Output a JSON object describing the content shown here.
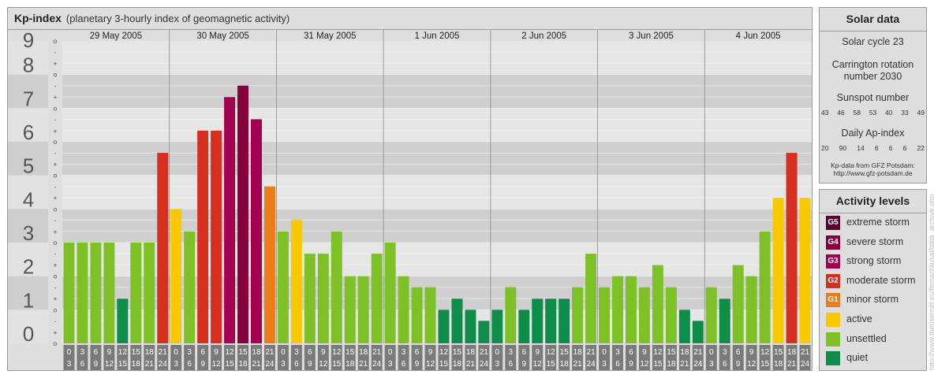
{
  "header": {
    "title": "Kp-index",
    "subtitle": "(planetary 3-hourly index of geomagnetic activity)"
  },
  "chart_data": {
    "type": "bar",
    "days": [
      "29 May 2005",
      "30 May 2005",
      "31 May 2005",
      "1 Jun 2005",
      "2 Jun 2005",
      "3 Jun 2005",
      "4 Jun 2005"
    ],
    "interval_labels": [
      [
        "0",
        "3"
      ],
      [
        "3",
        "6"
      ],
      [
        "6",
        "9"
      ],
      [
        "9",
        "12"
      ],
      [
        "12",
        "15"
      ],
      [
        "15",
        "18"
      ],
      [
        "18",
        "21"
      ],
      [
        "21",
        "24"
      ]
    ],
    "y_ticks": [
      "0",
      "1",
      "2",
      "3",
      "4",
      "5",
      "6",
      "7",
      "8",
      "9"
    ],
    "minor_ticks": [
      "o",
      "+",
      "-"
    ],
    "ylim": [
      0,
      9
    ],
    "values": [
      3.0,
      3.0,
      3.0,
      3.0,
      1.33,
      3.0,
      3.0,
      5.67,
      4.0,
      3.33,
      6.33,
      6.33,
      7.33,
      7.67,
      6.67,
      4.67,
      3.33,
      3.67,
      2.67,
      2.67,
      3.33,
      2.0,
      2.0,
      2.67,
      3.0,
      2.0,
      1.67,
      1.67,
      1.0,
      1.33,
      1.0,
      0.67,
      1.0,
      1.67,
      1.0,
      1.33,
      1.33,
      1.33,
      1.67,
      2.67,
      1.67,
      2.0,
      2.0,
      1.67,
      2.33,
      1.67,
      1.0,
      0.67,
      1.67,
      1.33,
      2.33,
      2.0,
      3.33,
      4.33,
      5.67,
      4.33
    ],
    "colors": {
      "quiet": "#0e8c4a",
      "unsettled": "#7dc126",
      "active": "#f9c800",
      "G1": "#ec7c1a",
      "G2": "#d42f1f",
      "G3": "#a5004f",
      "G4": "#86003e",
      "G5": "#5a0030"
    }
  },
  "solar": {
    "title": "Solar data",
    "cycle": "Solar cycle 23",
    "carrington_1": "Carrington rotation",
    "carrington_2": "number 2030",
    "sunspot_title": "Sunspot number",
    "sunspots": [
      "43",
      "46",
      "58",
      "53",
      "40",
      "33",
      "49"
    ],
    "ap_title": "Daily Ap-index",
    "ap": [
      "20",
      "90",
      "14",
      "6",
      "6",
      "6",
      "22"
    ],
    "credit_1": "Kp-data from GFZ Potsdam:",
    "credit_2": "http://www.gfz-potsdam.de"
  },
  "activity": {
    "title": "Activity levels",
    "items": [
      {
        "badge": "G5",
        "label": "extreme storm",
        "color": "#5a0030"
      },
      {
        "badge": "G4",
        "label": "severe storm",
        "color": "#86003e"
      },
      {
        "badge": "G3",
        "label": "strong storm",
        "color": "#a5004f"
      },
      {
        "badge": "G2",
        "label": "moderate storm",
        "color": "#d42f1f"
      },
      {
        "badge": "G1",
        "label": "minor storm",
        "color": "#ec7c1a"
      },
      {
        "badge": "",
        "label": "active",
        "color": "#f9c800"
      },
      {
        "badge": "",
        "label": "unsettled",
        "color": "#7dc126"
      },
      {
        "badge": "",
        "label": "quiet",
        "color": "#0e8c4a"
      }
    ]
  },
  "watermark": "http://www.theusernet.eu/fernarl/ausat/data_archive.php"
}
